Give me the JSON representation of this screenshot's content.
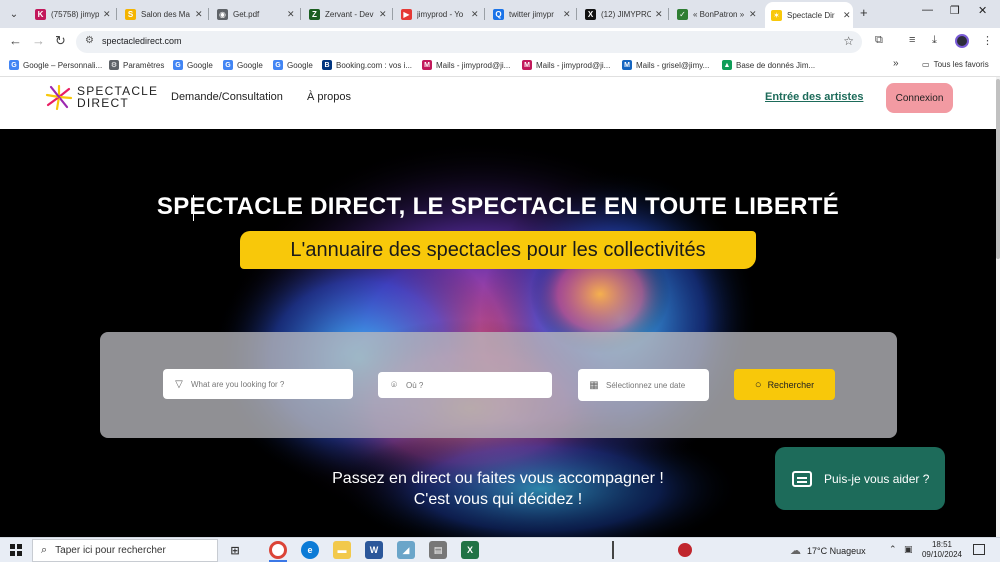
{
  "browser": {
    "tabs": [
      {
        "title": "(75758) jimyp",
        "icon": "k-icon",
        "color": "#c2185b",
        "glyph": "K"
      },
      {
        "title": "Salon des Ma",
        "icon": "note-icon",
        "color": "#f4b400",
        "glyph": "S"
      },
      {
        "title": "Get.pdf",
        "icon": "globe-icon",
        "color": "#5f6368",
        "glyph": "◉"
      },
      {
        "title": "Zervant - Dev",
        "icon": "zervant-icon",
        "color": "#1b5e20",
        "glyph": "Z"
      },
      {
        "title": "jimyprod - Yo",
        "icon": "youtube-icon",
        "color": "#e53935",
        "glyph": "▶"
      },
      {
        "title": "twitter jimypr",
        "icon": "search-icon",
        "color": "#1a73e8",
        "glyph": "Q"
      },
      {
        "title": "(12) JIMYPRC",
        "icon": "x-icon",
        "color": "#111111",
        "glyph": "X"
      },
      {
        "title": "« BonPatron »",
        "icon": "bonpatron-icon",
        "color": "#2e7d32",
        "glyph": "✓"
      },
      {
        "title": "Spectacle Dir",
        "icon": "spectacle-icon",
        "color": "#f8c80a",
        "glyph": "✶"
      }
    ],
    "url": "spectacledirect.com"
  },
  "bookmarks": {
    "items": [
      {
        "label": "Google – Personnali...",
        "color": "#4285f4",
        "glyph": "G"
      },
      {
        "label": "Paramètres",
        "color": "#5f6368",
        "glyph": "⚙"
      },
      {
        "label": "Google",
        "color": "#4285f4",
        "glyph": "G"
      },
      {
        "label": "Google",
        "color": "#4285f4",
        "glyph": "G"
      },
      {
        "label": "Google",
        "color": "#4285f4",
        "glyph": "G"
      },
      {
        "label": "Booking.com : vos i...",
        "color": "#003580",
        "glyph": "B"
      },
      {
        "label": "Mails - jimyprod@ji...",
        "color": "#c2185b",
        "glyph": "M"
      },
      {
        "label": "Mails - jimyprod@ji...",
        "color": "#c2185b",
        "glyph": "M"
      },
      {
        "label": "Mails - grisel@jimy...",
        "color": "#1565c0",
        "glyph": "M"
      },
      {
        "label": "Base de donnés Jim...",
        "color": "#0f9d58",
        "glyph": "▲"
      }
    ],
    "more": "»",
    "all_favorites": "Tous les favoris"
  },
  "site": {
    "logo_line1": "SPECTACLE",
    "logo_line2": "DIRECT",
    "nav": [
      "Demande/Consultation",
      "À propos"
    ],
    "artists_link": "Entrée des artistes",
    "login": "Connexion",
    "colors": {
      "accent_yellow": "#f8c80a",
      "accent_green": "#1d6b5a",
      "login_pink": "#f29aa2"
    }
  },
  "hero": {
    "title": "SPECTACLE DIRECT, LE SPECTACLE EN TOUTE LIBERTÉ",
    "subtitle": "L'annuaire des spectacles pour les collectivités",
    "search": {
      "what_placeholder": "What are you looking for ?",
      "where_placeholder": "Où ?",
      "date_placeholder": "Sélectionnez une date",
      "button": "Rechercher"
    },
    "tagline1": "Passez en direct ou faites vous accompagner !",
    "tagline2": "C'est vous qui décidez !",
    "help": "Puis-je vous aider ?"
  },
  "taskbar": {
    "search_placeholder": "Taper ici pour rechercher",
    "weather": "17°C  Nuageux",
    "time": "18:51",
    "date": "09/10/2024"
  }
}
